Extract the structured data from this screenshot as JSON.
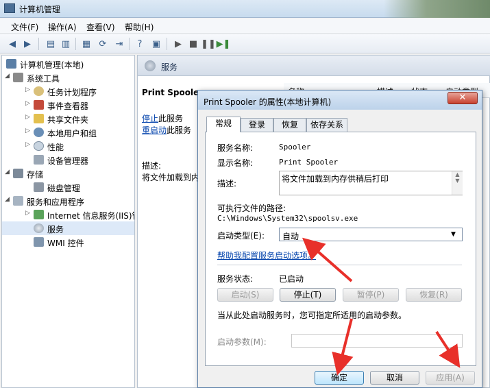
{
  "window": {
    "title": "计算机管理"
  },
  "menu": [
    "文件(F)",
    "操作(A)",
    "查看(V)",
    "帮助(H)"
  ],
  "tree": {
    "root": "计算机管理(本地)",
    "items": [
      {
        "label": "系统工具",
        "icon": "tools-icon"
      },
      {
        "label": "任务计划程序",
        "icon": "clock-icon"
      },
      {
        "label": "事件查看器",
        "icon": "event-viewer-icon"
      },
      {
        "label": "共享文件夹",
        "icon": "shared-folder-icon"
      },
      {
        "label": "本地用户和组",
        "icon": "users-icon"
      },
      {
        "label": "性能",
        "icon": "performance-icon"
      },
      {
        "label": "设备管理器",
        "icon": "device-manager-icon"
      },
      {
        "label": "存储",
        "icon": "storage-icon"
      },
      {
        "label": "磁盘管理",
        "icon": "disk-icon"
      },
      {
        "label": "服务和应用程序",
        "icon": "services-apps-icon"
      },
      {
        "label": "Internet 信息服务(IIS)管",
        "icon": "iis-icon"
      },
      {
        "label": "服务",
        "icon": "gear-icon"
      },
      {
        "label": "WMI 控件",
        "icon": "wmi-icon"
      }
    ]
  },
  "right": {
    "header": "服务",
    "service_name": "Print Spooler",
    "stop_link": "停止",
    "stop_suffix": "此服务",
    "restart_link": "重启动",
    "restart_suffix": "此服务",
    "desc_label": "描述:",
    "desc_text": "将文件加载到内",
    "columns": [
      "名称",
      "描述",
      "状态",
      "启动类型"
    ]
  },
  "dialog": {
    "title": "Print Spooler 的属性(本地计算机)",
    "tabs": [
      "常规",
      "登录",
      "恢复",
      "依存关系"
    ],
    "service_name_label": "服务名称:",
    "service_name_value": "Spooler",
    "display_name_label": "显示名称:",
    "display_name_value": "Print Spooler",
    "desc_label": "描述:",
    "desc_value": "将文件加载到内存供稍后打印",
    "path_label": "可执行文件的路径:",
    "path_value": "C:\\Windows\\System32\\spoolsv.exe",
    "startup_label": "启动类型(E):",
    "startup_value": "自动",
    "help_link": "帮助我配置服务启动选项。",
    "status_label": "服务状态:",
    "status_value": "已启动",
    "start_btn": "启动(S)",
    "stop_btn": "停止(T)",
    "pause_btn": "暂停(P)",
    "resume_btn": "恢复(R)",
    "hint": "当从此处启动服务时，您可指定所适用的启动参数。",
    "param_label": "启动参数(M):",
    "ok_btn": "确定",
    "cancel_btn": "取消",
    "apply_btn": "应用(A)"
  },
  "colors": {
    "arrow": "#e8302a",
    "link": "#0645ad"
  }
}
